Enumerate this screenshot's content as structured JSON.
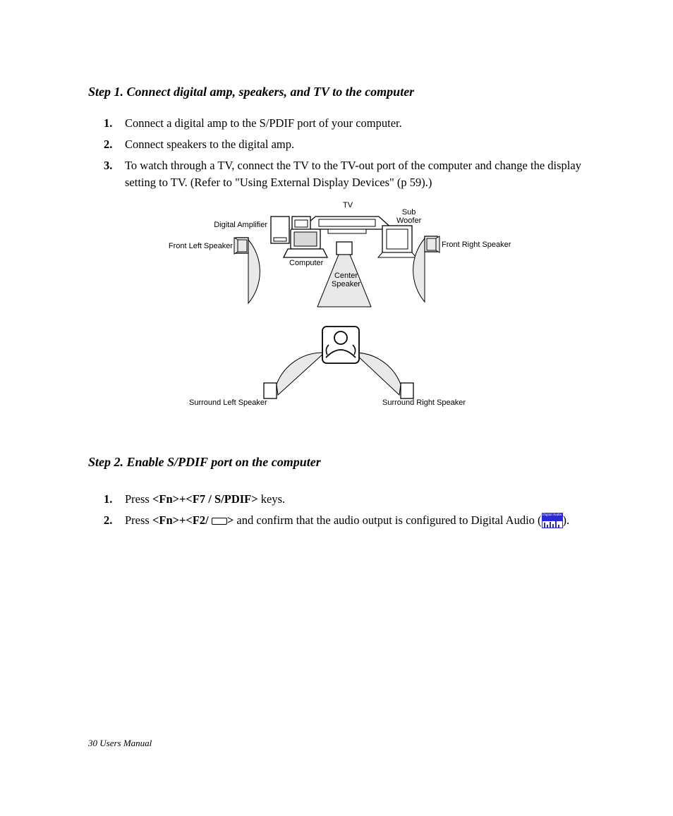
{
  "step1": {
    "heading": "Step 1. Connect digital amp, speakers, and TV to the computer",
    "items": [
      {
        "n": "1.",
        "text": "Connect a digital amp to the S/PDIF port of your computer."
      },
      {
        "n": "2.",
        "text": "Connect speakers to the digital amp."
      },
      {
        "n": "3.",
        "text": "To watch through a TV, connect the TV to the TV-out port of the computer and change the display setting to TV. (Refer to \"Using External Display Devices\" (p 59).)"
      }
    ]
  },
  "diagram": {
    "labels": {
      "digital_amp": "Digital Amplifier",
      "tv": "TV",
      "sub_woofer": "Sub\nWoofer",
      "computer": "Computer",
      "center_speaker": "Center\nSpeaker",
      "front_left": "Front Left Speaker",
      "front_right": "Front Right Speaker",
      "surround_left": "Surround Left Speaker",
      "surround_right": "Surround Right Speaker"
    }
  },
  "step2": {
    "heading": "Step 2. Enable S/PDIF port on the computer",
    "items": [
      {
        "n": "1.",
        "pre": "Press ",
        "key": "<Fn>+<F7 / S/PDIF>",
        "post": " keys."
      },
      {
        "n": "2.",
        "pre": "Press ",
        "key": "<Fn>+<F2/ ",
        "key_post": ">",
        "mid": " and confirm that the audio output is configured to Digital Audio (",
        "end": ")."
      }
    ]
  },
  "footer": "30  Users Manual"
}
